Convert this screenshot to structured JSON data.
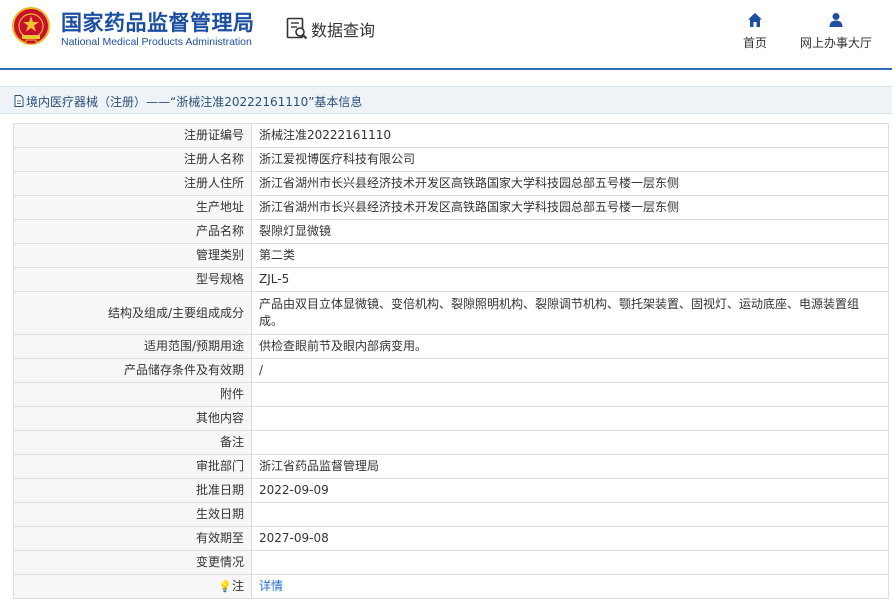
{
  "header": {
    "org_cn": "国家药品监督管理局",
    "org_en": "National Medical Products Administration",
    "query_label": "数据查询",
    "nav": [
      {
        "label": "首页",
        "icon": "home-icon"
      },
      {
        "label": "网上办事大厅",
        "icon": "user-icon"
      }
    ],
    "brand_color": "#1d4fa1"
  },
  "breadcrumb": {
    "text": "境内医疗器械（注册）——“浙械注准20222161110”基本信息",
    "icon": "document-icon"
  },
  "record": {
    "rows": [
      {
        "label": "注册证编号",
        "value": "浙械注准20222161110"
      },
      {
        "label": "注册人名称",
        "value": "浙江爱视博医疗科技有限公司"
      },
      {
        "label": "注册人住所",
        "value": "浙江省湖州市长兴县经济技术开发区高铁路国家大学科技园总部五号楼一层东侧"
      },
      {
        "label": "生产地址",
        "value": "浙江省湖州市长兴县经济技术开发区高铁路国家大学科技园总部五号楼一层东侧"
      },
      {
        "label": "产品名称",
        "value": "裂隙灯显微镜"
      },
      {
        "label": "管理类别",
        "value": "第二类"
      },
      {
        "label": "型号规格",
        "value": "ZJL-5"
      },
      {
        "label": "结构及组成/主要组成成分",
        "value": "产品由双目立体显微镜、变倍机构、裂隙照明机构、裂隙调节机构、颚托架装置、固视灯、运动底座、电源装置组成。"
      },
      {
        "label": "适用范围/预期用途",
        "value": "供检查眼前节及眼内部病变用。"
      },
      {
        "label": "产品储存条件及有效期",
        "value": "/"
      },
      {
        "label": "附件",
        "value": ""
      },
      {
        "label": "其他内容",
        "value": ""
      },
      {
        "label": "备注",
        "value": ""
      },
      {
        "label": "审批部门",
        "value": "浙江省药品监督管理局"
      },
      {
        "label": "批准日期",
        "value": "2022-09-09"
      },
      {
        "label": "生效日期",
        "value": ""
      },
      {
        "label": "有效期至",
        "value": "2027-09-08"
      },
      {
        "label": "变更情况",
        "value": ""
      }
    ],
    "note": {
      "glyph": "💡",
      "label": "注",
      "link": "详情"
    }
  }
}
